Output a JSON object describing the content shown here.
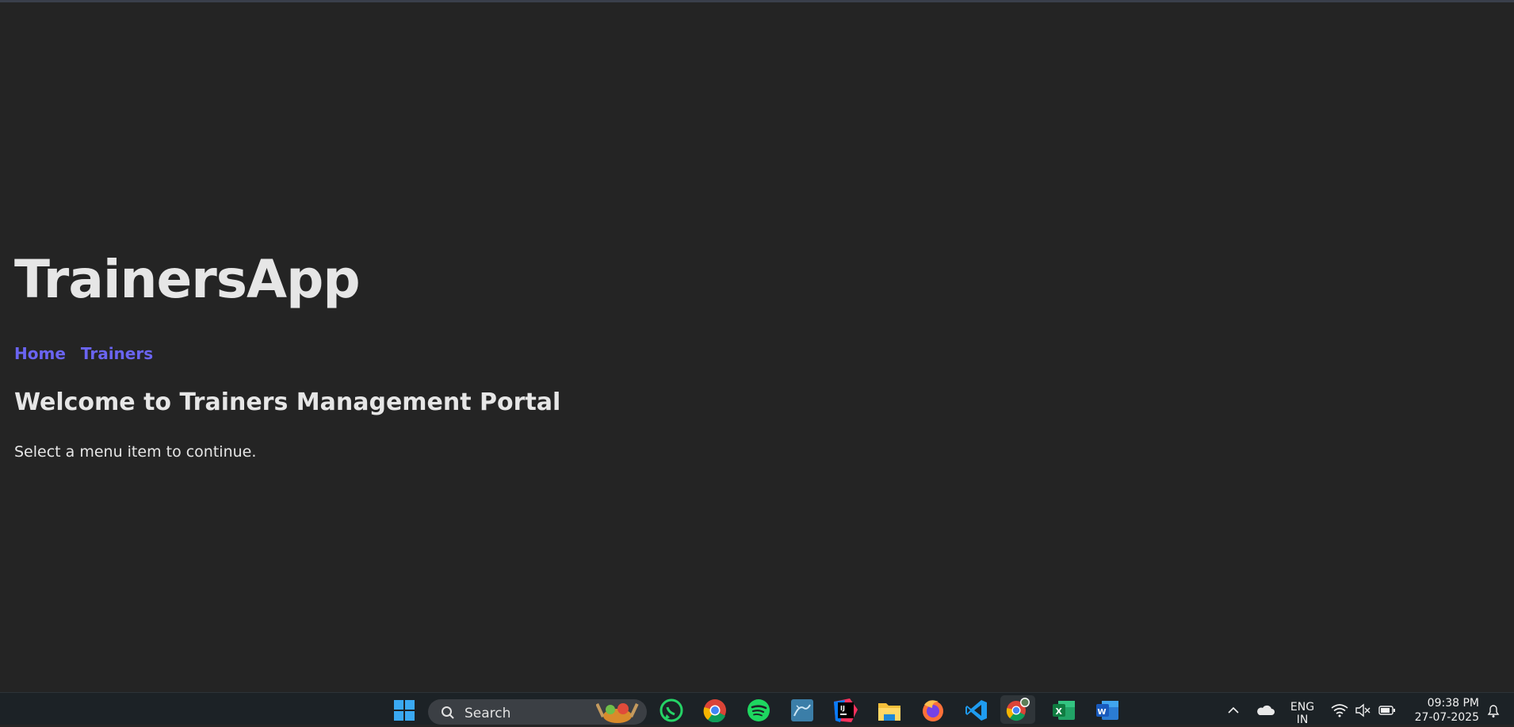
{
  "app": {
    "title": "TrainersApp",
    "nav": [
      {
        "label": "Home"
      },
      {
        "label": "Trainers"
      }
    ],
    "heading": "Welcome to Trainers Management Portal",
    "message": "Select a menu item to continue."
  },
  "colors": {
    "background": "#242424",
    "text": "#e6e6e6",
    "link": "#6a64f1",
    "taskbar": "#1c2226"
  },
  "taskbar": {
    "search_label": "Search",
    "apps": [
      "windows-start-icon",
      "whatsapp-icon",
      "chrome-icon",
      "spotify-icon",
      "mysql-workbench-icon",
      "intellij-icon",
      "file-explorer-icon",
      "firefox-icon",
      "vscode-icon",
      "chrome-profile-icon",
      "excel-icon",
      "word-icon"
    ],
    "tray": {
      "language_line1": "ENG",
      "language_line2": "IN",
      "time": "09:38 PM",
      "date": "27-07-2025"
    }
  }
}
